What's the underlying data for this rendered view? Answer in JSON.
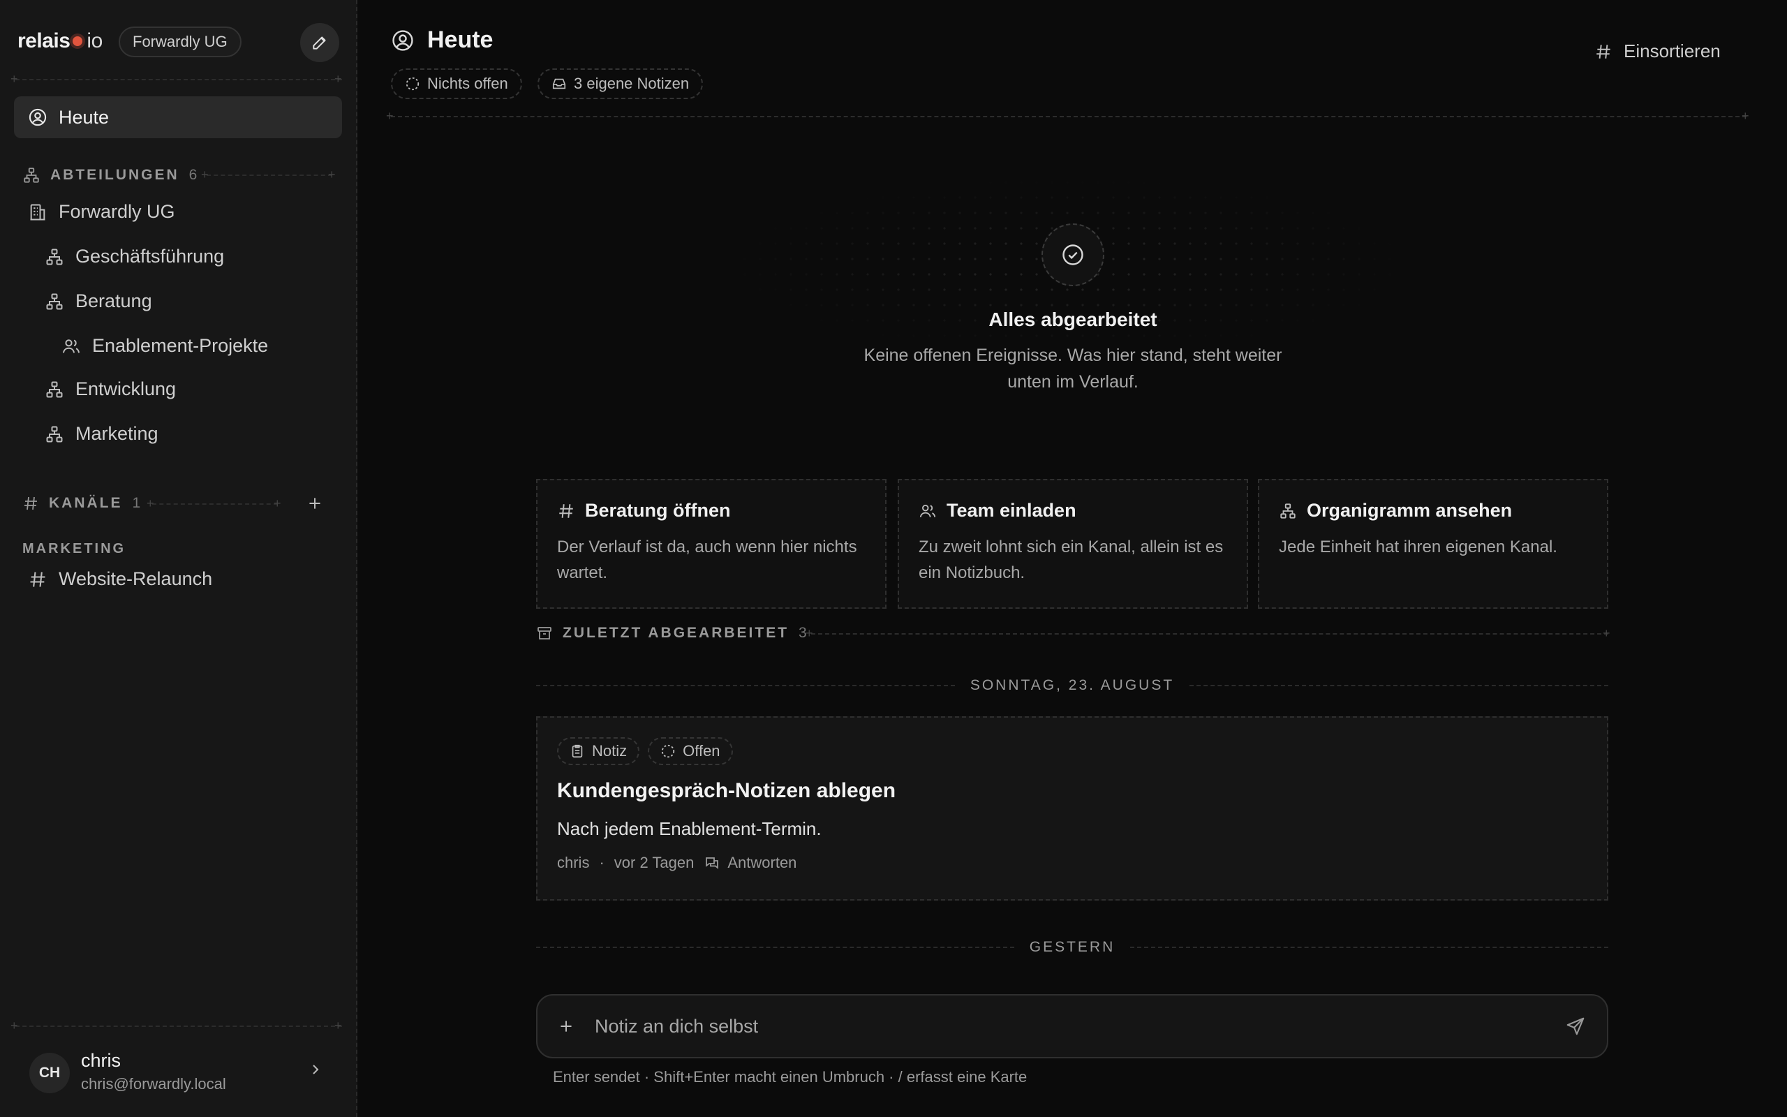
{
  "brand": {
    "name": "relais",
    "suffix": "io",
    "accent": "#e2553e"
  },
  "workspace": {
    "name": "Forwardly UG"
  },
  "nav": {
    "today": "Heute"
  },
  "departments": {
    "label": "ABTEILUNGEN",
    "count": "6",
    "items": [
      {
        "label": "Forwardly UG",
        "icon": "building-icon"
      },
      {
        "label": "Geschäftsführung",
        "icon": "org-chart-icon"
      },
      {
        "label": "Beratung",
        "icon": "org-chart-icon"
      },
      {
        "label": "Enablement-Projekte",
        "icon": "users-icon"
      },
      {
        "label": "Entwicklung",
        "icon": "org-chart-icon"
      },
      {
        "label": "Marketing",
        "icon": "org-chart-icon"
      }
    ]
  },
  "channels": {
    "label": "KANÄLE",
    "count": "1",
    "group": "MARKETING",
    "items": [
      {
        "label": "Website-Relaunch",
        "icon": "hash-icon"
      }
    ]
  },
  "user": {
    "initials": "CH",
    "name": "chris",
    "email": "chris@forwardly.local"
  },
  "header": {
    "title": "Heute",
    "pills": [
      "Nichts offen",
      "3 eigene Notizen"
    ],
    "sort_label": "Einsortieren"
  },
  "empty_state": {
    "title": "Alles abgearbeitet",
    "text": "Keine offenen Ereignisse. Was hier stand, steht weiter unten im Verlauf."
  },
  "cards": [
    {
      "title": "Beratung öffnen",
      "text": "Der Verlauf ist da, auch wenn hier nichts wartet.",
      "icon": "hash-icon"
    },
    {
      "title": "Team einladen",
      "text": "Zu zweit lohnt sich ein Kanal, allein ist es ein Notizbuch.",
      "icon": "users-icon"
    },
    {
      "title": "Organigramm ansehen",
      "text": "Jede Einheit hat ihren eigenen Kanal.",
      "icon": "org-chart-icon"
    }
  ],
  "recent": {
    "label": "ZULETZT ABGEARBEITET",
    "count": "3"
  },
  "timeline": {
    "date1": "SONNTAG, 23. AUGUST",
    "date2": "GESTERN",
    "event": {
      "tags": [
        "Notiz",
        "Offen"
      ],
      "title": "Kundengespräch-Notizen ablegen",
      "body": "Nach jedem Enablement-Termin.",
      "author": "chris",
      "dot": "·",
      "time": "vor 2 Tagen",
      "reply": "Antworten"
    }
  },
  "composer": {
    "placeholder": "Notiz an dich selbst",
    "hint": "Enter sendet · Shift+Enter macht einen Umbruch · / erfasst eine Karte"
  }
}
